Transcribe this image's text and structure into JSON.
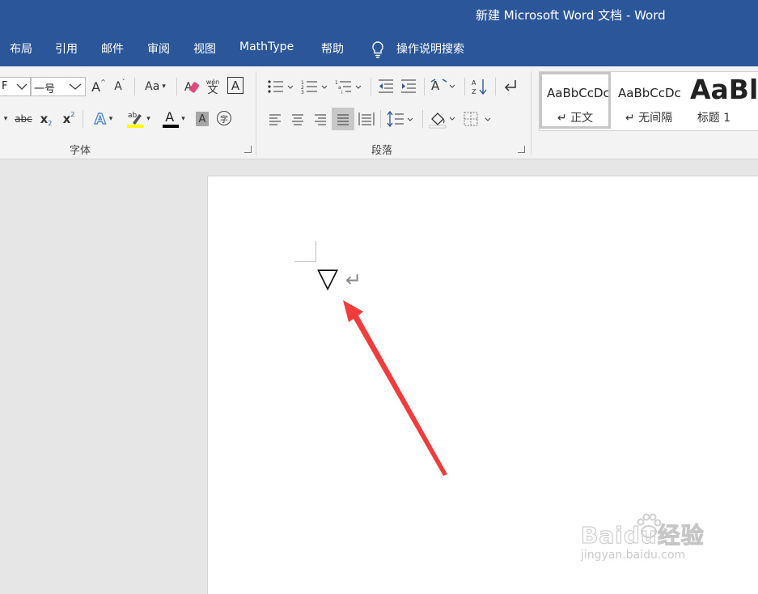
{
  "window": {
    "title": "新建 Microsoft Word 文档  -  Word"
  },
  "tabs": [
    "布局",
    "引用",
    "邮件",
    "审阅",
    "视图",
    "MathType",
    "帮助"
  ],
  "tell_me": {
    "label": "操作说明搜索"
  },
  "font_group": {
    "label": "字体",
    "font_name_value": "F",
    "font_size_value": "一号",
    "change_case_label": "Aa",
    "strikethrough_label": "abc",
    "subscript_label": "x",
    "superscript_label": "x",
    "grow_font_label": "A",
    "shrink_font_label": "A",
    "text_effects_label": "A",
    "font_color_label": "A",
    "char_shading_label": "A",
    "phonetic_label": "wén",
    "border_char_label": "A",
    "enclose_char_label": "字"
  },
  "paragraph_group": {
    "label": "段落"
  },
  "styles_group": {
    "items": [
      {
        "preview": "AaBbCcDc",
        "name": "↵ 正文"
      },
      {
        "preview": "AaBbCcDc",
        "name": "↵ 无间隔"
      },
      {
        "preview": "AaBl",
        "name": "标题 1"
      }
    ]
  },
  "document": {
    "symbol": "▽",
    "paragraph_mark": "↵"
  },
  "watermark": {
    "text": "Baidu经验",
    "sub": "jingyan.baidu.com"
  },
  "colors": {
    "titlebar": "#2b579a",
    "ribbon": "#f3f3f3",
    "highlight": "#ffff00",
    "font_color": "#000000",
    "arrow": "#f03c3c"
  }
}
